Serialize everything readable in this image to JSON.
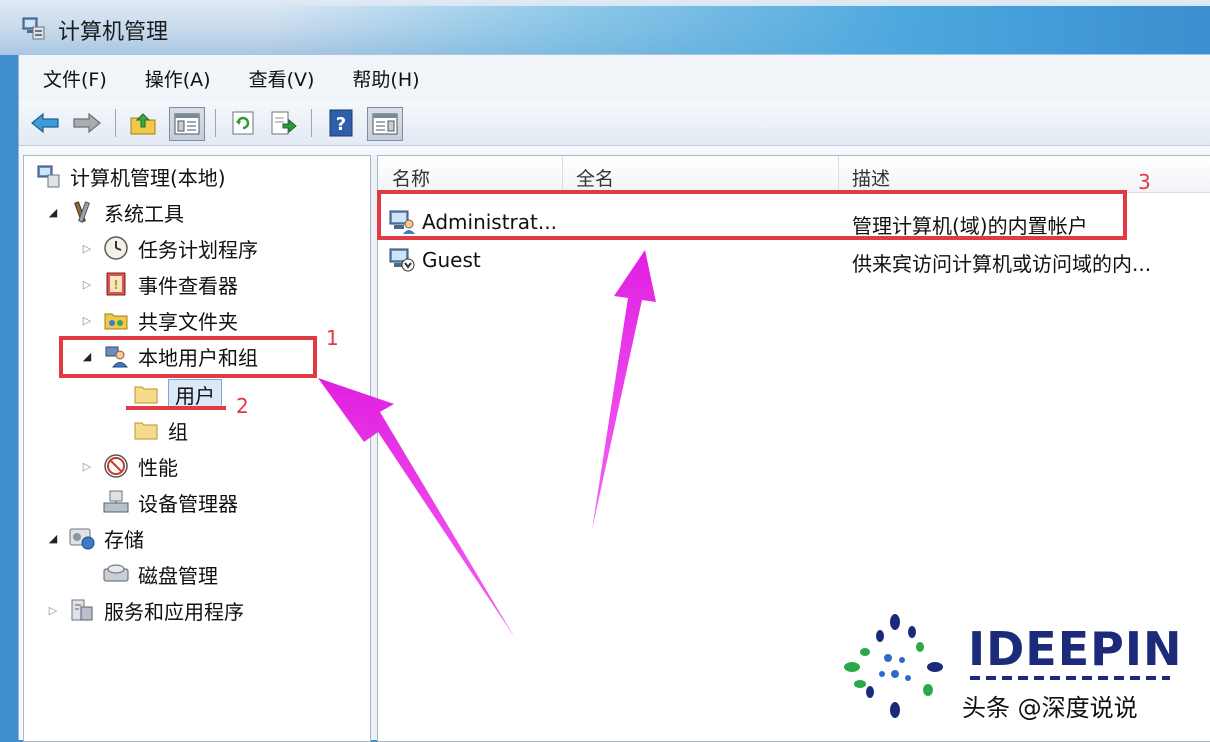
{
  "window": {
    "title": "计算机管理"
  },
  "menu": [
    "文件(F)",
    "操作(A)",
    "查看(V)",
    "帮助(H)"
  ],
  "toolbar": [
    "back-icon",
    "forward-icon",
    "up-folder-icon",
    "show-tree-icon",
    "refresh-icon",
    "export-icon",
    "help-icon",
    "action-pane-icon"
  ],
  "tree": {
    "root": "计算机管理(本地)",
    "system_tools": "系统工具",
    "task_scheduler": "任务计划程序",
    "event_viewer": "事件查看器",
    "shared_folders": "共享文件夹",
    "local_users_groups": "本地用户和组",
    "users": "用户",
    "groups": "组",
    "performance": "性能",
    "device_manager": "设备管理器",
    "storage": "存储",
    "disk_management": "磁盘管理",
    "services_apps": "服务和应用程序"
  },
  "list": {
    "columns": [
      "名称",
      "全名",
      "描述"
    ],
    "rows": [
      {
        "name": "Administrat...",
        "full_name": "",
        "description": "管理计算机(域)的内置帐户"
      },
      {
        "name": "Guest",
        "full_name": "",
        "description": "供来宾访问计算机或访问域的内..."
      }
    ]
  },
  "annotations": {
    "n1": "1",
    "n2": "2",
    "n3": "3",
    "highlight_color": "#e03a44",
    "arrow_color": "#ee22ee"
  },
  "watermark": {
    "brand": "IDEEPIN",
    "caption": "头条 @深度说说"
  }
}
